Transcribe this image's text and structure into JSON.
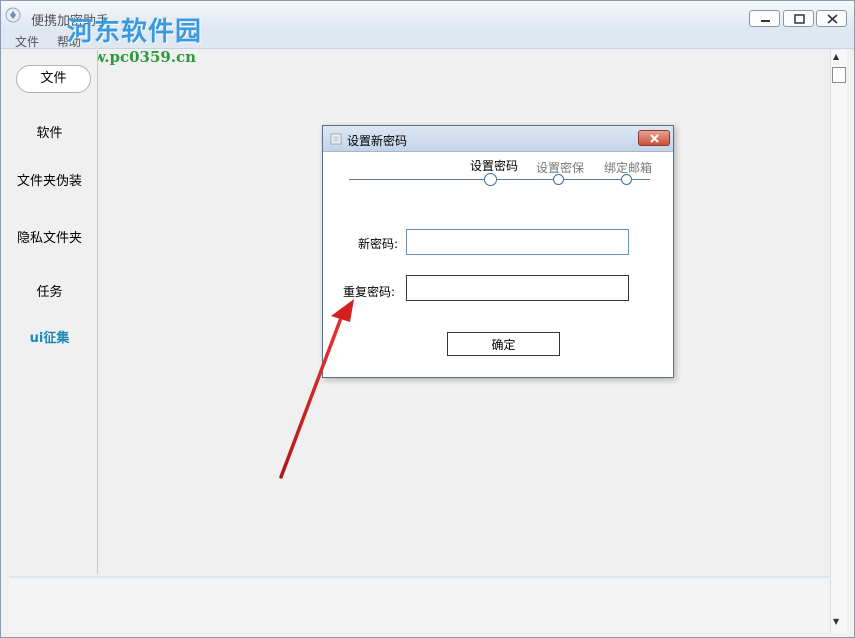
{
  "window": {
    "title": "便携加密助手",
    "menu": [
      "文件",
      "帮助"
    ]
  },
  "watermark": {
    "title": "河东软件园",
    "url": "www.pc0359.cn"
  },
  "sidebar": {
    "items": [
      {
        "label": "文件"
      },
      {
        "label": "软件"
      },
      {
        "label": "文件夹伪装"
      },
      {
        "label": "隐私文件夹"
      },
      {
        "label": "任务"
      },
      {
        "label": "ui征集"
      }
    ]
  },
  "dialog": {
    "title": "设置新密码",
    "steps": [
      {
        "label": "设置密码"
      },
      {
        "label": "设置密保"
      },
      {
        "label": "绑定邮箱"
      }
    ],
    "fields": {
      "new_password_label": "新密码:",
      "new_password_value": "",
      "repeat_password_label": "重复密码:",
      "repeat_password_value": ""
    },
    "confirm_label": "确定"
  },
  "colors": {
    "accent": "#1a8ab8",
    "annotation_arrow": "#d42020",
    "watermark_blue": "#3a9ae0",
    "watermark_green": "#2a9a3a"
  }
}
